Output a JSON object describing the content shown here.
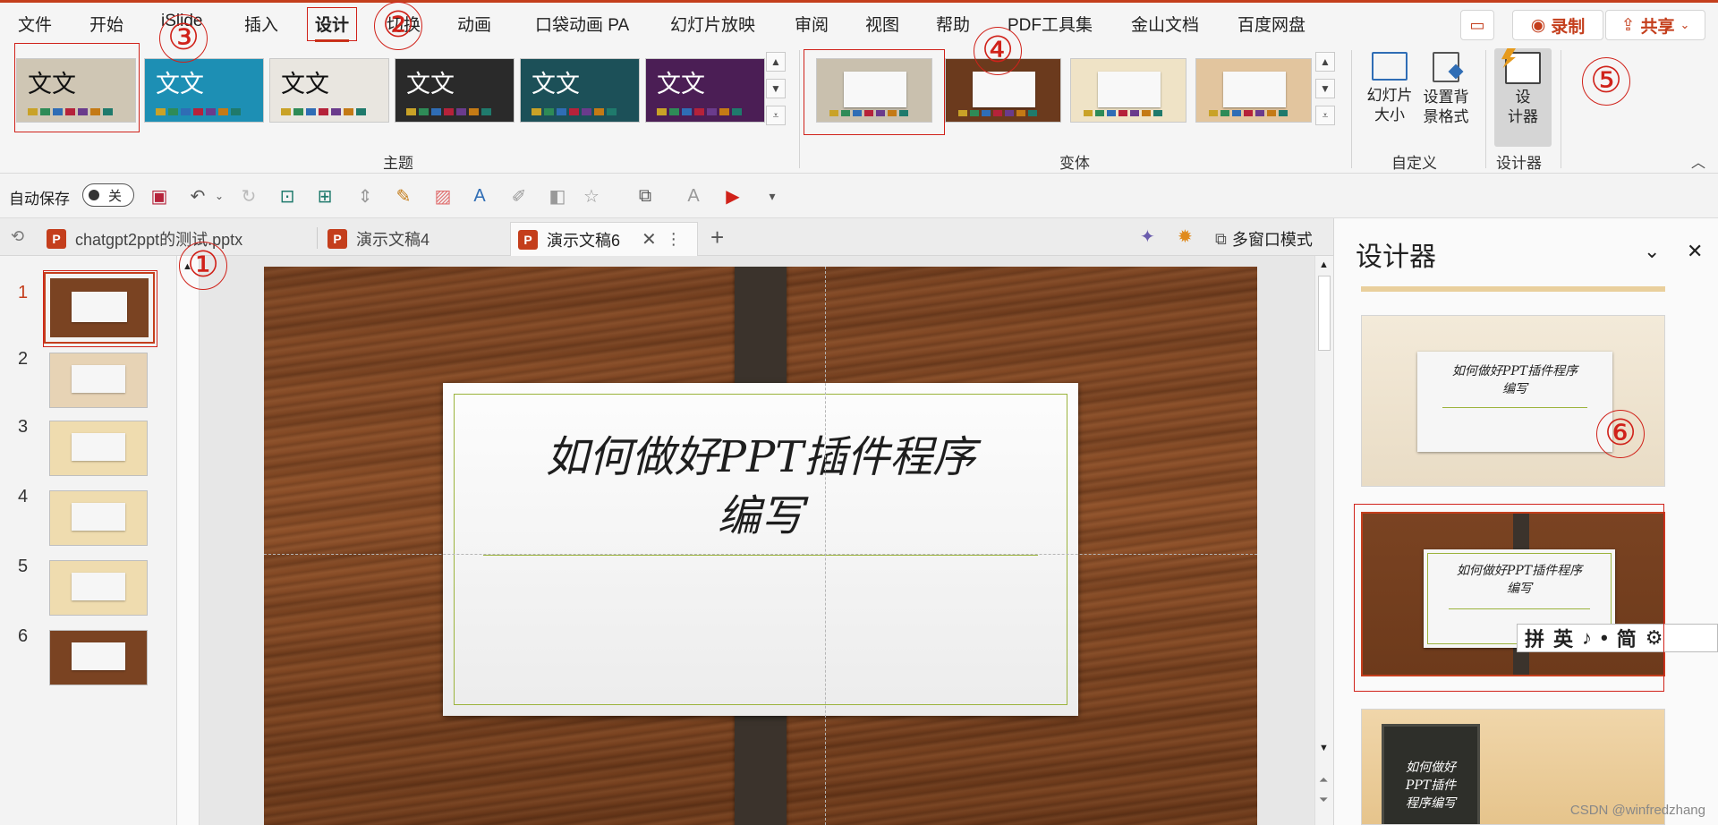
{
  "ribbon_tabs": [
    "文件",
    "开始",
    "iSlide",
    "插入",
    "设计",
    "切换",
    "动画",
    "口袋动画 PA",
    "幻灯片放映",
    "审阅",
    "视图",
    "帮助",
    "PDF工具集",
    "金山文档",
    "百度网盘"
  ],
  "active_tab": "设计",
  "top_buttons": {
    "record": "录制",
    "share": "共享"
  },
  "themes": {
    "label": "主题",
    "items": [
      {
        "text": "文文",
        "bg": "#cfc6b4",
        "fg": "#111"
      },
      {
        "text": "文文",
        "bg": "#1d8fb4",
        "fg": "#ffffff"
      },
      {
        "text": "文文",
        "bg": "#e9e6e0",
        "fg": "#111"
      },
      {
        "text": "文文",
        "bg": "#2a2a2a",
        "fg": "#ffffff"
      },
      {
        "text": "文文",
        "bg": "#1c5058",
        "fg": "#ffffff"
      },
      {
        "text": "文文",
        "bg": "#4b1e55",
        "fg": "#ffffff"
      }
    ]
  },
  "variants": {
    "label": "变体",
    "items": [
      {
        "bg": "#c9c0ae"
      },
      {
        "bg": "#6b3a1d"
      },
      {
        "bg": "#efe3c6"
      },
      {
        "bg": "#e2c59e"
      }
    ]
  },
  "customize": {
    "label": "自定义",
    "slide_size": "幻灯片\n大小",
    "format_background": "设置背\n景格式"
  },
  "designer_group": {
    "label": "设计器",
    "button": "设\n计器"
  },
  "autosave": {
    "label": "自动保存",
    "state": "关"
  },
  "doc_tabs": [
    {
      "title": "chatgpt2ppt的测试.pptx",
      "active": false
    },
    {
      "title": "演示文稿4",
      "active": false
    },
    {
      "title": "演示文稿6",
      "active": true
    }
  ],
  "multiwindow": "多窗口模式",
  "slides": [
    {
      "num": "1",
      "selected": true,
      "bg": "#7a4322"
    },
    {
      "num": "2",
      "selected": false,
      "bg": "#e7d3b5"
    },
    {
      "num": "3",
      "selected": false,
      "bg": "#efdcaf"
    },
    {
      "num": "4",
      "selected": false,
      "bg": "#efdcaf"
    },
    {
      "num": "5",
      "selected": false,
      "bg": "#efdcaf"
    },
    {
      "num": "6",
      "selected": false,
      "bg": "#7a4322"
    }
  ],
  "slide_title": "如何做好PPT插件程序\n编写",
  "designer_pane": {
    "title": "设计器",
    "thumb_title": "如何做好PPT插件程序\n编写",
    "thumb3_title": "如何做好\nPPT插件\n程序编写"
  },
  "ime_bar": [
    "拼",
    "英",
    "♪",
    "•",
    "简",
    "⚙"
  ],
  "annotations": [
    "①",
    "②",
    "③",
    "④",
    "⑤",
    "⑥"
  ],
  "watermark": "CSDN @winfredzhang"
}
